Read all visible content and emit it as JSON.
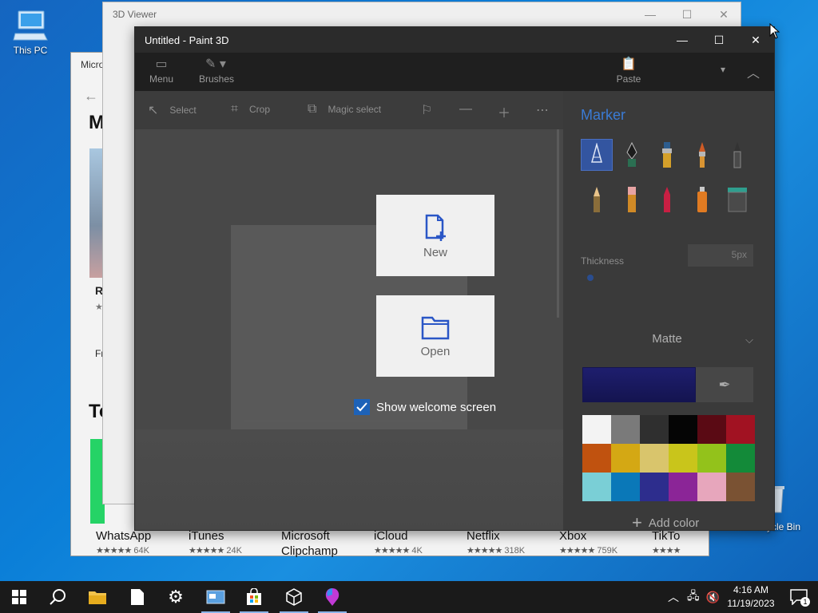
{
  "desktop": {
    "this_pc": "This PC",
    "recycle_bin": "Recycle Bin",
    "recycle_bin_visible": "ycle Bin"
  },
  "store": {
    "title": "Micro",
    "heading1": "M",
    "hero_r": "R",
    "hero_f": "Fr",
    "heading2": "To",
    "apps": [
      {
        "name": "WhatsApp",
        "stars": "★★★★★",
        "count": "64K"
      },
      {
        "name": "iTunes",
        "stars": "★★★★★",
        "count": "24K"
      },
      {
        "name": "Microsoft Clipchamp",
        "stars": "",
        "count": ""
      },
      {
        "name": "iCloud",
        "stars": "★★★★★",
        "count": "4K"
      },
      {
        "name": "Netflix",
        "stars": "★★★★★",
        "count": "318K"
      },
      {
        "name": "Xbox",
        "stars": "★★★★★",
        "count": "759K"
      },
      {
        "name": "TikTo",
        "stars": "★★★★",
        "count": ""
      }
    ]
  },
  "viewer": {
    "title": "3D Viewer"
  },
  "paint": {
    "title": "Untitled - Paint 3D",
    "ribbon": {
      "menu": "Menu",
      "brushes": "Brushes",
      "paste": "Paste"
    },
    "toolbar": {
      "select": "Select",
      "crop": "Crop",
      "magic_select": "Magic select"
    },
    "panel": {
      "title": "Marker",
      "thickness_label": "Thickness",
      "thickness_value": "5px",
      "finish": "Matte",
      "add_color": "Add color",
      "current_color": "#1e1e6e",
      "palette": [
        "#f3f3f3",
        "#7a7a7a",
        "#2f2f2f",
        "#050505",
        "#5a0a14",
        "#a11222",
        "#c0520f",
        "#d4a814",
        "#d9c56c",
        "#c9c51b",
        "#93c21b",
        "#138a39",
        "#7acfd6",
        "#0a78b8",
        "#2d2d8d",
        "#8b2597",
        "#e7a6bc",
        "#7a5233"
      ]
    },
    "welcome": {
      "new_label": "New",
      "open_label": "Open",
      "show_welcome": "Show welcome screen"
    }
  },
  "taskbar": {
    "time": "4:16 AM",
    "date": "11/19/2023",
    "notifications": "1"
  },
  "colors": {
    "accent": "#3a7bd5",
    "checkbox": "#1d62b8"
  }
}
